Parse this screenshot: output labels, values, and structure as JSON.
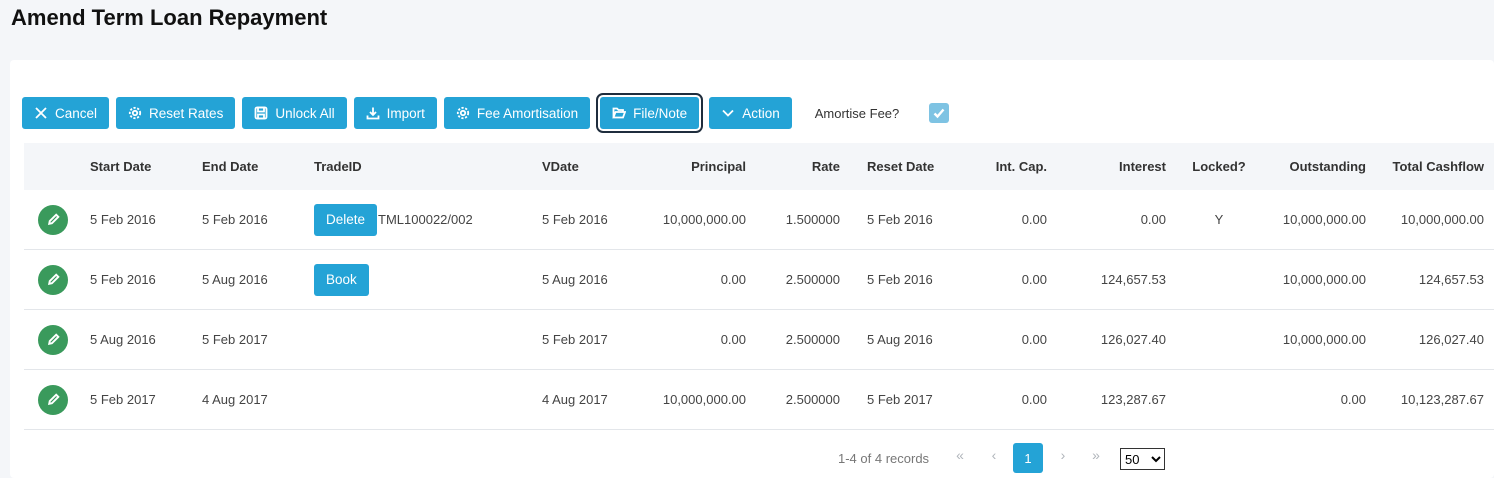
{
  "page": {
    "title": "Amend Term Loan Repayment"
  },
  "toolbar": {
    "cancel": "Cancel",
    "reset_rates": "Reset Rates",
    "unlock_all": "Unlock All",
    "import": "Import",
    "fee_amortisation": "Fee Amortisation",
    "file_note": "File/Note",
    "action": "Action",
    "amortise_fee_label": "Amortise Fee?",
    "amortise_fee_checked": true
  },
  "table": {
    "headers": {
      "start_date": "Start Date",
      "end_date": "End Date",
      "trade_id": "TradeID",
      "vdate": "VDate",
      "principal": "Principal",
      "rate": "Rate",
      "reset_date": "Reset Date",
      "int_cap": "Int. Cap.",
      "interest": "Interest",
      "locked": "Locked?",
      "outstanding": "Outstanding",
      "total_cashflow": "Total Cashflow"
    },
    "rows": [
      {
        "start_date": "5 Feb 2016",
        "end_date": "5 Feb 2016",
        "button": "Delete",
        "trade_id": "TML100022/002",
        "vdate": "5 Feb 2016",
        "principal": "10,000,000.00",
        "rate": "1.500000",
        "reset_date": "5 Feb 2016",
        "int_cap": "0.00",
        "interest": "0.00",
        "locked": "Y",
        "outstanding": "10,000,000.00",
        "total_cashflow": "10,000,000.00"
      },
      {
        "start_date": "5 Feb 2016",
        "end_date": "5 Aug 2016",
        "button": "Book",
        "trade_id": "",
        "vdate": "5 Aug 2016",
        "principal": "0.00",
        "rate": "2.500000",
        "reset_date": "5 Feb 2016",
        "int_cap": "0.00",
        "interest": "124,657.53",
        "locked": "",
        "outstanding": "10,000,000.00",
        "total_cashflow": "124,657.53"
      },
      {
        "start_date": "5 Aug 2016",
        "end_date": "5 Feb 2017",
        "button": "",
        "trade_id": "",
        "vdate": "5 Feb 2017",
        "principal": "0.00",
        "rate": "2.500000",
        "reset_date": "5 Aug 2016",
        "int_cap": "0.00",
        "interest": "126,027.40",
        "locked": "",
        "outstanding": "10,000,000.00",
        "total_cashflow": "126,027.40"
      },
      {
        "start_date": "5 Feb 2017",
        "end_date": "4 Aug 2017",
        "button": "",
        "trade_id": "",
        "vdate": "4 Aug 2017",
        "principal": "10,000,000.00",
        "rate": "2.500000",
        "reset_date": "5 Feb 2017",
        "int_cap": "0.00",
        "interest": "123,287.67",
        "locked": "",
        "outstanding": "0.00",
        "total_cashflow": "10,123,287.67"
      }
    ]
  },
  "pager": {
    "info": "1-4 of 4 records",
    "first": "«",
    "prev": "‹",
    "next": "›",
    "last": "»",
    "current_page": "1",
    "page_size": "50"
  },
  "colors": {
    "accent": "#24a3d6",
    "edit": "#3a9a5c"
  }
}
